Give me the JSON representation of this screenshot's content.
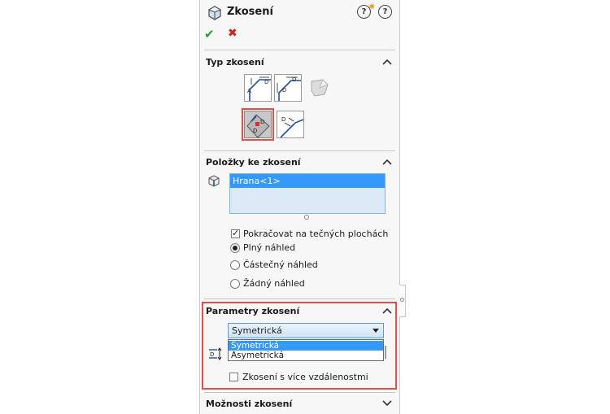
{
  "header": {
    "title": "Zkosení",
    "help_label": "?",
    "ok_symbol": "✔",
    "cancel_symbol": "✖"
  },
  "sections": {
    "type": {
      "title": "Typ zkosení"
    },
    "items": {
      "title": "Položky ke zkosení"
    },
    "params": {
      "title": "Parametry zkosení"
    },
    "options": {
      "title": "Možnosti zkosení"
    }
  },
  "items_list": [
    "Hrana<1>"
  ],
  "options": {
    "tangent_label": "Pokračovat na tečných plochách",
    "tangent_checked": true,
    "preview_full": "Plný náhled",
    "preview_partial": "Částečný náhled",
    "preview_none": "Žádný náhled",
    "preview_selected": "full"
  },
  "params": {
    "dropdown_value": "Symetrická",
    "dropdown_options": [
      "Symetrická",
      "Asymetrická"
    ],
    "multi_distance_label": "Zkosení s více vzdálenostmi",
    "multi_distance_checked": false
  },
  "icons": {
    "feature": "chamfer-feature-icon",
    "help": "help-icon",
    "whats-new": "whats-new-help-icon",
    "ok": "checkmark-icon",
    "cancel": "close-icon",
    "edge": "edge-icon",
    "distance": "distance-icon"
  },
  "colors": {
    "accent": "#3399ff",
    "highlight_frame": "#d9534f",
    "ok": "#2e9a2e",
    "cancel": "#cc2222"
  }
}
